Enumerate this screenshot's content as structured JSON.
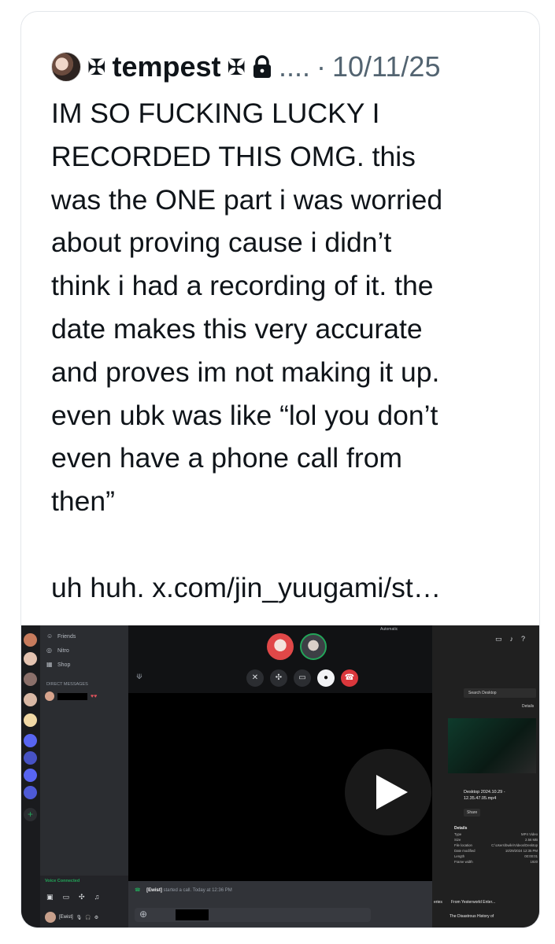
{
  "post": {
    "cross_left": "✠",
    "display_name": "tempest",
    "cross_right": "✠",
    "ellipsis": "....",
    "separator": "·",
    "date": "10/11/25",
    "text": "IM SO FUCKING LUCKY I\nRECORDED THIS OMG. this\nwas the ONE part i was worried\nabout proving cause i didn’t\nthink i had a recording of it. the\ndate makes this very accurate\nand proves im not making it up.\neven ubk was like “lol you don’t\neven have a phone call from\nthen”\n\nuh huh. x.com/jin_yuugami/st…",
    "icons": [
      "avatar",
      "lock-icon",
      "play-icon"
    ]
  },
  "video": {
    "discord": {
      "nav_items": [
        "Friends",
        "Nitro",
        "Shop"
      ],
      "dm_header": "DIRECT MESSAGES",
      "dm_plus": "+",
      "voice_connected": "Voice Connected",
      "user_name": "[Ewist]",
      "mode_label": "Automatic",
      "chat_message_name": "[Ewist]",
      "chat_message_rest": "started a call.  Today at 12:36 PM"
    },
    "explorer": {
      "search_placeholder": "Search Desktop",
      "details_label": "Details",
      "file_name": "Desktop 2024.10.29 - 12.35.47.05.mp4",
      "share_label": "Share",
      "props_header": "Details",
      "props": [
        {
          "k": "Type",
          "v": "MP4 Video"
        },
        {
          "k": "Size",
          "v": "2.56 MB"
        },
        {
          "k": "File location",
          "v": "C:\\Users\\bwile\\Videos\\Desktop"
        },
        {
          "k": "Date modified",
          "v": "10/29/2024 12:35 PM"
        },
        {
          "k": "Length",
          "v": "00:00:01"
        },
        {
          "k": "Frame width",
          "v": "1920"
        }
      ],
      "yt_left": "eries",
      "yt_channel": "From Yesterworld Enter...",
      "yt_title": "The Disastrous History of"
    }
  }
}
